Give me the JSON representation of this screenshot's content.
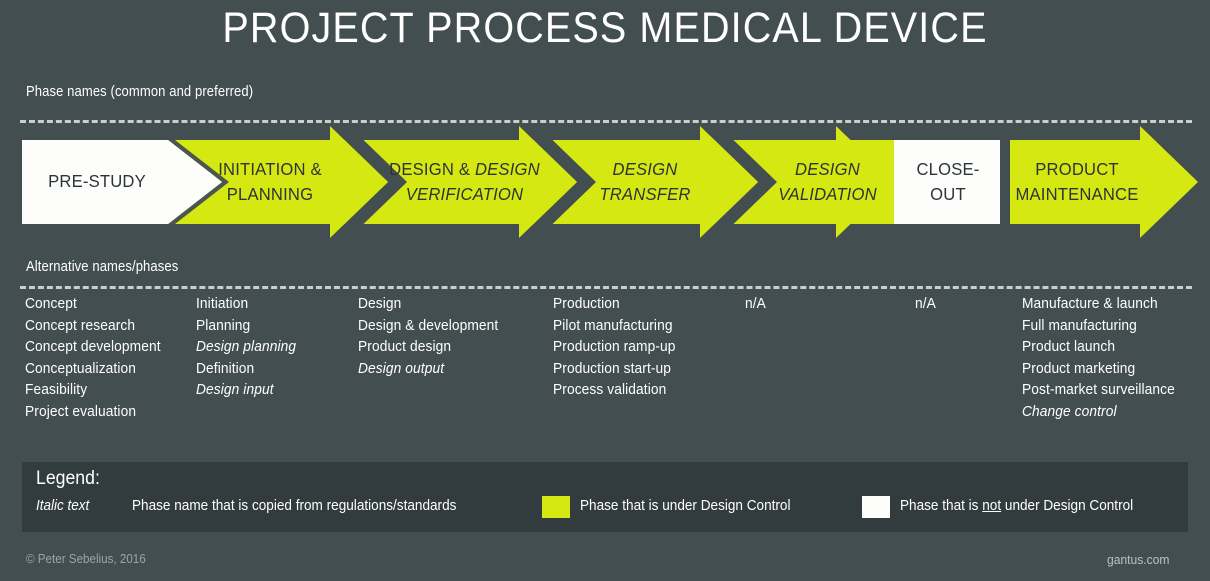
{
  "title": "PROJECT PROCESS MEDICAL DEVICE",
  "colors": {
    "background": "#434e50",
    "accent_yellow": "#d6e812",
    "phase_white": "#fdfdfb",
    "legend_panel": "#323b3d",
    "dash_line": "#c9cfd0"
  },
  "sections": {
    "phase_caption": "Phase names (common and preferred)",
    "alt_caption": "Alternative names/phases"
  },
  "phases": [
    {
      "line1": "PRE-STUDY",
      "line2": "",
      "style": "white",
      "italic1": false,
      "italic2": false
    },
    {
      "line1": "INITIATION &",
      "line2": "PLANNING",
      "style": "yellow",
      "italic1": false,
      "italic2": false
    },
    {
      "line1": "DESIGN & ",
      "line2": "VERIFICATION",
      "style": "yellow",
      "italic1": "partial",
      "italic2": true,
      "line1_italic_tail": "DESIGN"
    },
    {
      "line1": "DESIGN",
      "line2": "TRANSFER",
      "style": "yellow",
      "italic1": true,
      "italic2": true
    },
    {
      "line1": "DESIGN",
      "line2": "VALIDATION",
      "style": "yellow",
      "italic1": true,
      "italic2": true
    },
    {
      "line1": "CLOSE-",
      "line2": "OUT",
      "style": "white",
      "italic1": false,
      "italic2": false
    },
    {
      "line1": "PRODUCT",
      "line2": "MAINTENANCE",
      "style": "yellow",
      "italic1": false,
      "italic2": false
    }
  ],
  "alt_columns": [
    {
      "items": [
        {
          "text": "Concept",
          "italic": false
        },
        {
          "text": "Concept research",
          "italic": false
        },
        {
          "text": "Concept development",
          "italic": false
        },
        {
          "text": "Conceptualization",
          "italic": false
        },
        {
          "text": "Feasibility",
          "italic": false
        },
        {
          "text": "Project evaluation",
          "italic": false
        }
      ]
    },
    {
      "items": [
        {
          "text": "Initiation",
          "italic": false
        },
        {
          "text": "Planning",
          "italic": false
        },
        {
          "text": "Design planning",
          "italic": true
        },
        {
          "text": "Definition",
          "italic": false
        },
        {
          "text": "Design input",
          "italic": true
        }
      ]
    },
    {
      "items": [
        {
          "text": "Design",
          "italic": false
        },
        {
          "text": "Design & development",
          "italic": false
        },
        {
          "text": "Product design",
          "italic": false
        },
        {
          "text": "Design output",
          "italic": true
        }
      ]
    },
    {
      "items": [
        {
          "text": "Production",
          "italic": false
        },
        {
          "text": "Pilot manufacturing",
          "italic": false
        },
        {
          "text": "Production ramp-up",
          "italic": false
        },
        {
          "text": "Production start-up",
          "italic": false
        },
        {
          "text": "Process validation",
          "italic": false
        }
      ]
    },
    {
      "items": [
        {
          "text": "n/A",
          "italic": false
        }
      ]
    },
    {
      "items": [
        {
          "text": "n/A",
          "italic": false
        }
      ]
    },
    {
      "items": [
        {
          "text": "Manufacture & launch",
          "italic": false
        },
        {
          "text": "Full manufacturing",
          "italic": false
        },
        {
          "text": "Product launch",
          "italic": false
        },
        {
          "text": "Product marketing",
          "italic": false
        },
        {
          "text": "Post-market surveillance",
          "italic": false
        },
        {
          "text": "Change control",
          "italic": true
        }
      ]
    }
  ],
  "legend": {
    "title": "Legend:",
    "italic_key": "Italic text",
    "italic_desc": "Phase name that is copied from regulations/standards",
    "yellow_desc_pre": "Phase that is under Design Control",
    "white_desc_a": "Phase that is ",
    "white_desc_not": "not",
    "white_desc_b": " under Design Control"
  },
  "footer": {
    "copyright": "© Peter Sebelius, 2016",
    "site": "gantus.com"
  }
}
